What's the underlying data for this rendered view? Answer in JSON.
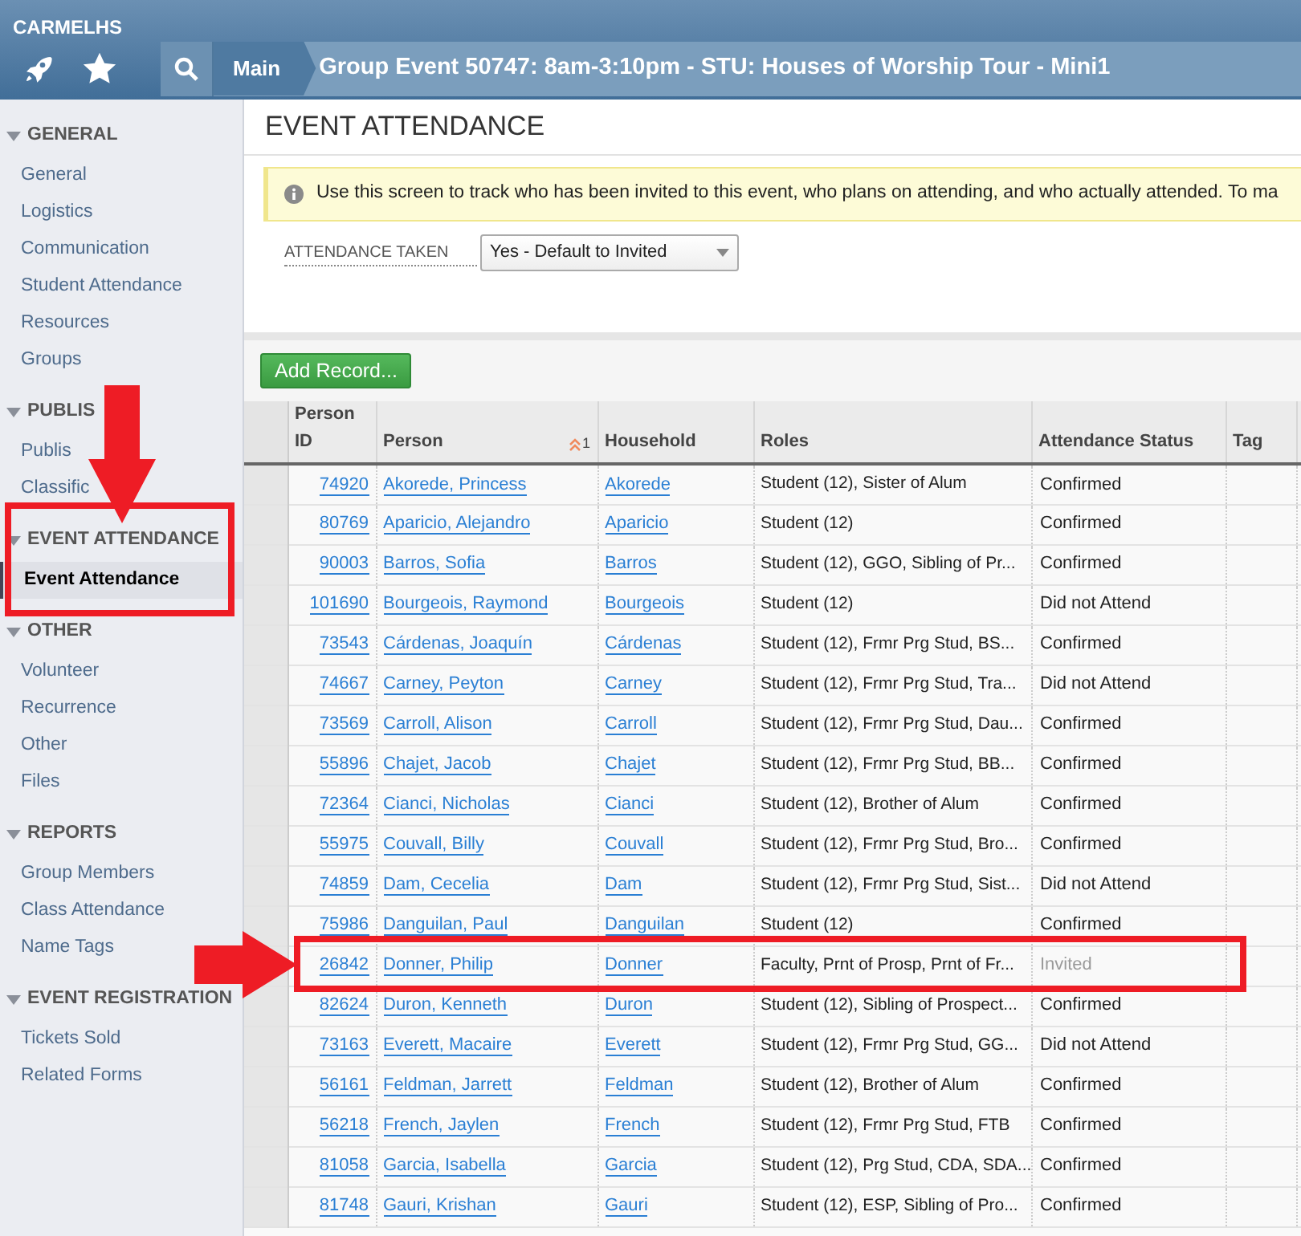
{
  "header": {
    "org": "CARMELHS",
    "crumb": "Main",
    "title": "Group Event 50747: 8am-3:10pm - STU: Houses of Worship Tour - Mini1"
  },
  "sidebar": [
    {
      "title": "GENERAL",
      "items": [
        {
          "label": "General",
          "selected": false
        },
        {
          "label": "Logistics",
          "selected": false
        },
        {
          "label": "Communication",
          "selected": false
        },
        {
          "label": "Student Attendance",
          "selected": false
        },
        {
          "label": "Resources",
          "selected": false
        },
        {
          "label": "Groups",
          "selected": false
        }
      ]
    },
    {
      "title": "PUBLIS",
      "items": [
        {
          "label": "Publis",
          "selected": false
        },
        {
          "label": "Classific",
          "selected": false
        }
      ]
    },
    {
      "title": "EVENT ATTENDANCE",
      "items": [
        {
          "label": "Event Attendance",
          "selected": true
        }
      ]
    },
    {
      "title": "OTHER",
      "items": [
        {
          "label": "Volunteer",
          "selected": false
        },
        {
          "label": "Recurrence",
          "selected": false
        },
        {
          "label": "Other",
          "selected": false
        },
        {
          "label": "Files",
          "selected": false
        }
      ]
    },
    {
      "title": "REPORTS",
      "items": [
        {
          "label": "Group Members",
          "selected": false
        },
        {
          "label": "Class Attendance",
          "selected": false
        },
        {
          "label": "Name Tags",
          "selected": false
        }
      ]
    },
    {
      "title": "EVENT REGISTRATION",
      "items": [
        {
          "label": "Tickets Sold",
          "selected": false
        },
        {
          "label": "Related Forms",
          "selected": false
        }
      ]
    }
  ],
  "page_title": "EVENT ATTENDANCE",
  "info": "Use this screen to track who has been invited to this event, who plans on attending, and who actually attended. To ma",
  "attendance_taken": {
    "label": "ATTENDANCE TAKEN",
    "value": "Yes - Default to Invited"
  },
  "add_button": "Add Record...",
  "table": {
    "columns": [
      "Person ID",
      "Person",
      "Household",
      "Roles",
      "Attendance Status",
      "Tag"
    ],
    "sort_index": "1",
    "rows": [
      {
        "id": "74920",
        "person": "Akorede, Princess",
        "household": "Akorede",
        "roles": "Student (12), Sister of Alum",
        "status": "Confirmed",
        "dimmed": false
      },
      {
        "id": "80769",
        "person": "Aparicio, Alejandro",
        "household": "Aparicio",
        "roles": "Student (12)",
        "status": "Confirmed",
        "dimmed": false
      },
      {
        "id": "90003",
        "person": "Barros, Sofia",
        "household": "Barros",
        "roles": "Student (12), GGO, Sibling of Pr...",
        "status": "Confirmed",
        "dimmed": false
      },
      {
        "id": "101690",
        "person": "Bourgeois, Raymond",
        "household": "Bourgeois",
        "roles": "Student (12)",
        "status": "Did not Attend",
        "dimmed": false
      },
      {
        "id": "73543",
        "person": "Cárdenas, Joaquín",
        "household": "Cárdenas",
        "roles": "Student (12), Frmr Prg Stud, BS...",
        "status": "Confirmed",
        "dimmed": false
      },
      {
        "id": "74667",
        "person": "Carney, Peyton",
        "household": "Carney",
        "roles": "Student (12), Frmr Prg Stud, Tra...",
        "status": "Did not Attend",
        "dimmed": false
      },
      {
        "id": "73569",
        "person": "Carroll, Alison",
        "household": "Carroll",
        "roles": "Student (12), Frmr Prg Stud, Dau...",
        "status": "Confirmed",
        "dimmed": false
      },
      {
        "id": "55896",
        "person": "Chajet, Jacob",
        "household": "Chajet",
        "roles": "Student (12), Frmr Prg Stud, BB...",
        "status": "Confirmed",
        "dimmed": false
      },
      {
        "id": "72364",
        "person": "Cianci, Nicholas",
        "household": "Cianci",
        "roles": "Student (12), Brother of Alum",
        "status": "Confirmed",
        "dimmed": false
      },
      {
        "id": "55975",
        "person": "Couvall, Billy",
        "household": "Couvall",
        "roles": "Student (12), Frmr Prg Stud, Bro...",
        "status": "Confirmed",
        "dimmed": false
      },
      {
        "id": "74859",
        "person": "Dam, Cecelia",
        "household": "Dam",
        "roles": "Student (12), Frmr Prg Stud, Sist...",
        "status": "Did not Attend",
        "dimmed": false
      },
      {
        "id": "75986",
        "person": "Danguilan, Paul",
        "household": "Danguilan",
        "roles": "Student (12)",
        "status": "Confirmed",
        "dimmed": false
      },
      {
        "id": "26842",
        "person": "Donner, Philip",
        "household": "Donner",
        "roles": "Faculty, Prnt of Prosp, Prnt of Fr...",
        "status": "Invited",
        "dimmed": true
      },
      {
        "id": "82624",
        "person": "Duron, Kenneth",
        "household": "Duron",
        "roles": "Student (12), Sibling of Prospect...",
        "status": "Confirmed",
        "dimmed": false
      },
      {
        "id": "73163",
        "person": "Everett, Macaire",
        "household": "Everett",
        "roles": "Student (12), Frmr Prg Stud, GG...",
        "status": "Did not Attend",
        "dimmed": false
      },
      {
        "id": "56161",
        "person": "Feldman, Jarrett",
        "household": "Feldman",
        "roles": "Student (12), Brother of Alum",
        "status": "Confirmed",
        "dimmed": false
      },
      {
        "id": "56218",
        "person": "French, Jaylen",
        "household": "French",
        "roles": "Student (12), Frmr Prg Stud, FTB",
        "status": "Confirmed",
        "dimmed": false
      },
      {
        "id": "81058",
        "person": "Garcia, Isabella",
        "household": "Garcia",
        "roles": "Student (12), Prg Stud, CDA, SDA...",
        "status": "Confirmed",
        "dimmed": false
      },
      {
        "id": "81748",
        "person": "Gauri, Krishan",
        "household": "Gauri",
        "roles": "Student (12), ESP, Sibling of Pro...",
        "status": "Confirmed",
        "dimmed": false
      }
    ]
  }
}
